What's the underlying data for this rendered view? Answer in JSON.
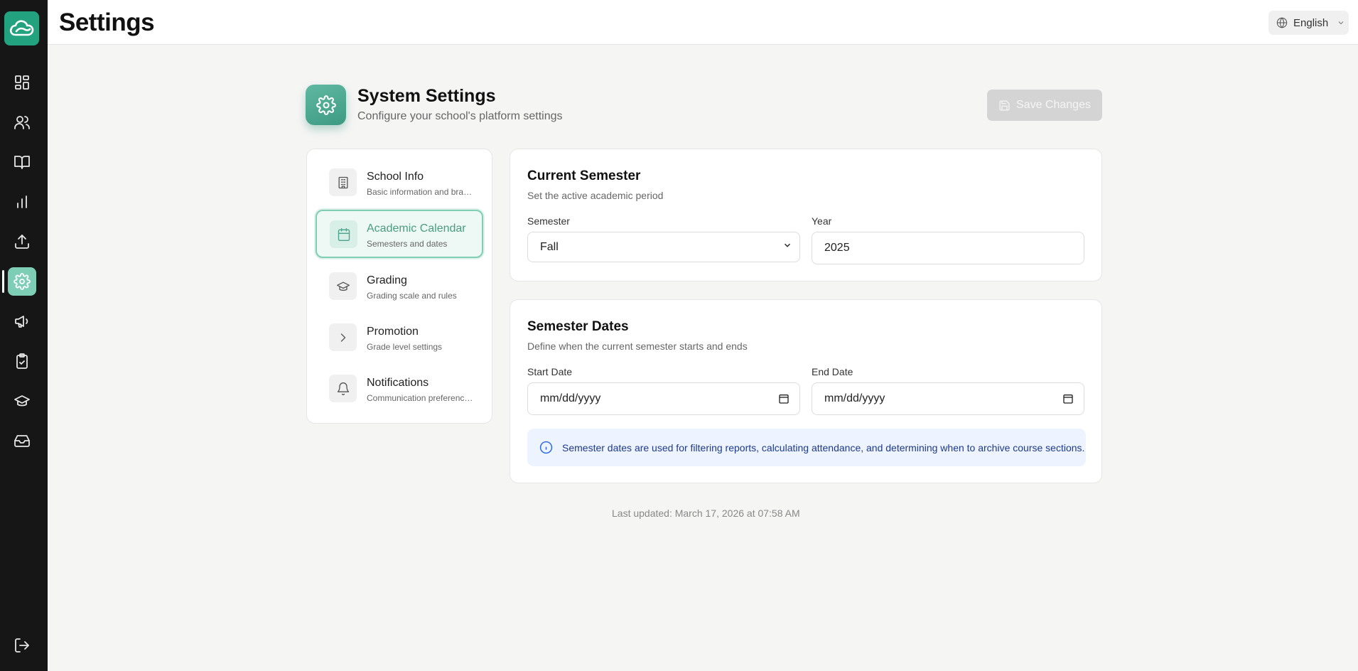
{
  "header": {
    "title": "Settings",
    "language": "English"
  },
  "sidebar": {
    "items": [
      {
        "icon": "dashboard-icon"
      },
      {
        "icon": "users-icon"
      },
      {
        "icon": "book-icon"
      },
      {
        "icon": "chart-icon"
      },
      {
        "icon": "upload-icon"
      },
      {
        "icon": "gear-icon",
        "active": true
      },
      {
        "icon": "megaphone-icon"
      },
      {
        "icon": "clipboard-check-icon"
      },
      {
        "icon": "graduation-cap-icon"
      },
      {
        "icon": "inbox-icon"
      }
    ],
    "logout_icon": "logout-icon"
  },
  "system": {
    "title": "System Settings",
    "subtitle": "Configure your school's platform settings",
    "save_label": "Save Changes"
  },
  "menu": {
    "items": [
      {
        "title": "School Info",
        "subtitle": "Basic information and branding"
      },
      {
        "title": "Academic Calendar",
        "subtitle": "Semesters and dates"
      },
      {
        "title": "Grading",
        "subtitle": "Grading scale and rules"
      },
      {
        "title": "Promotion",
        "subtitle": "Grade level settings"
      },
      {
        "title": "Notifications",
        "subtitle": "Communication preferences"
      }
    ]
  },
  "current_semester": {
    "title": "Current Semester",
    "subtitle": "Set the active academic period",
    "semester_label": "Semester",
    "semester_value": "Fall",
    "year_label": "Year",
    "year_value": "2025"
  },
  "semester_dates": {
    "title": "Semester Dates",
    "subtitle": "Define when the current semester starts and ends",
    "start_label": "Start Date",
    "start_placeholder": "mm/dd/yyyy",
    "end_label": "End Date",
    "end_placeholder": "mm/dd/yyyy",
    "info": "Semester dates are used for filtering reports, calculating attendance, and determining when to archive course sections."
  },
  "footer": {
    "last_updated": "Last updated: March 17, 2026 at 07:58 AM"
  }
}
